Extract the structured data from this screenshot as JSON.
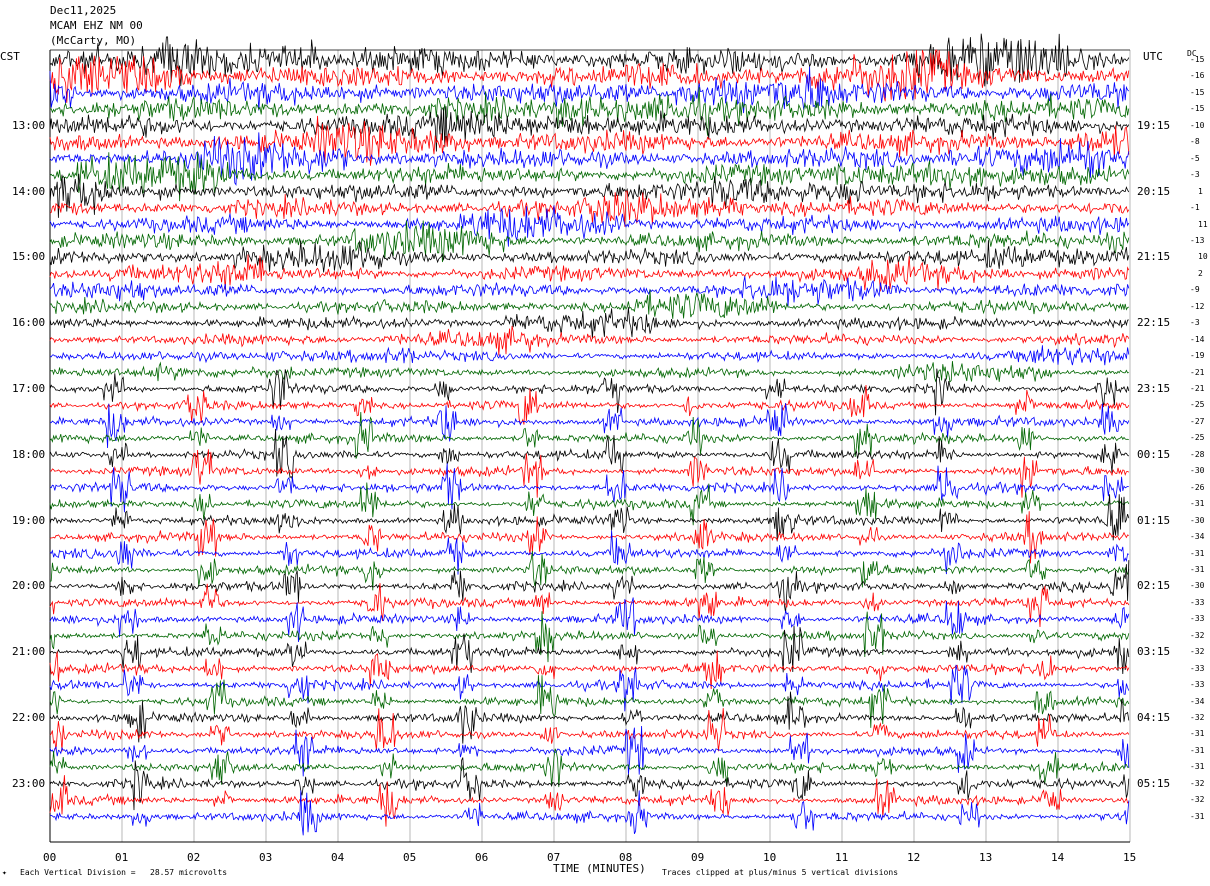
{
  "header": {
    "date": "Dec11,2025",
    "station": "MCAM EHZ NM 00",
    "location": "(McCarty, MO)"
  },
  "tz_left": "CST",
  "tz_right": "UTC",
  "dc_label": "DC",
  "footer": {
    "mark": "✦",
    "division": "Each Vertical Division =   28.57 microvolts",
    "clip": "Traces clipped at plus/minus 5 vertical divisions"
  },
  "chart_data": {
    "type": "line",
    "xlabel": "TIME (MINUTES)",
    "xlim": [
      0,
      15
    ],
    "x_ticks": [
      "00",
      "01",
      "02",
      "03",
      "04",
      "05",
      "06",
      "07",
      "08",
      "09",
      "10",
      "11",
      "12",
      "13",
      "14",
      "15"
    ],
    "left_hour_labels": [
      "13:00",
      "14:00",
      "15:00",
      "16:00",
      "17:00",
      "18:00",
      "19:00",
      "20:00",
      "21:00",
      "22:00",
      "23:00"
    ],
    "right_hour_labels": [
      "19:15",
      "20:15",
      "21:15",
      "22:15",
      "23:15",
      "00:15",
      "01:15",
      "02:15",
      "03:15",
      "04:15",
      "05:15"
    ],
    "trace_colors": [
      "#000000",
      "#ff0000",
      "#0000ff",
      "#006600"
    ],
    "dc_offsets": [
      -15,
      -16,
      -15,
      -15,
      -10,
      -8,
      -5,
      -3,
      1,
      -1,
      11,
      -13,
      10,
      2,
      -9,
      -12,
      -3,
      -14,
      -19,
      -21,
      -21,
      -25,
      -27,
      -25,
      -28,
      -30,
      -26,
      -31,
      -30,
      -34,
      -31,
      -31,
      -30,
      -33,
      -33,
      -32,
      -32,
      -33,
      -33,
      -34,
      -32,
      -31,
      -31,
      -31,
      -32,
      -32,
      -31
    ]
  }
}
